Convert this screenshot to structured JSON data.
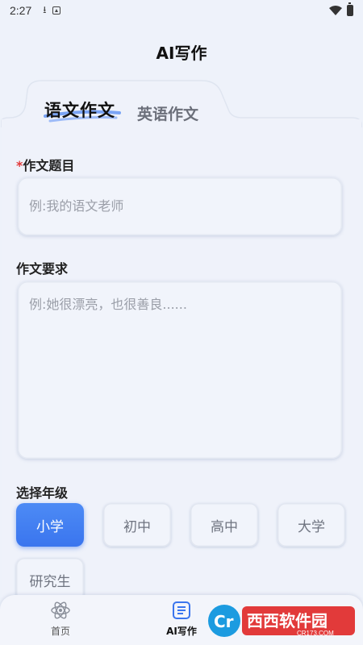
{
  "status_bar": {
    "time": "2:27"
  },
  "header": {
    "title": "AI写作"
  },
  "tabs": [
    {
      "label": "语文作文",
      "active": true
    },
    {
      "label": "英语作文",
      "active": false
    }
  ],
  "form": {
    "topic": {
      "required_mark": "*",
      "label": "作文题目",
      "placeholder": "例:我的语文老师"
    },
    "requirement": {
      "label": "作文要求",
      "placeholder": "例:她很漂亮，也很善良......"
    },
    "grade": {
      "label": "选择年级",
      "options": [
        "小学",
        "初中",
        "高中",
        "大学",
        "研究生"
      ],
      "selected": "小学"
    }
  },
  "bottom_nav": [
    {
      "label": "首页",
      "icon": "atom-icon",
      "active": false
    },
    {
      "label": "AI写作",
      "icon": "document-list-icon",
      "active": true
    }
  ],
  "watermark": {
    "text": "西西软件园",
    "sub": "CR173.COM",
    "logo": "Cr"
  },
  "colors": {
    "accent": "#3a75ee",
    "required": "#e23a3a",
    "background": "#eef2fa"
  }
}
